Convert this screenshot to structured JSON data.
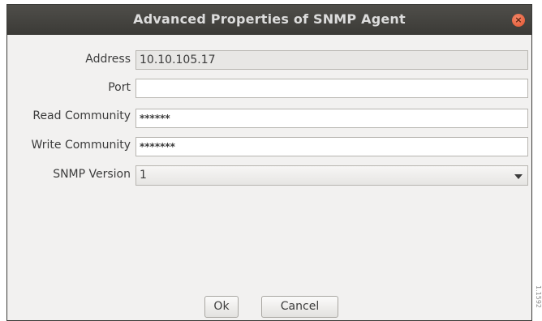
{
  "window": {
    "title": "Advanced Properties of SNMP Agent",
    "close_glyph": "×"
  },
  "form": {
    "address": {
      "label": "Address",
      "value": "10.10.105.17"
    },
    "port": {
      "label": "Port",
      "value": ""
    },
    "read_community": {
      "label": "Read Community",
      "value": "******"
    },
    "write_community": {
      "label": "Write Community",
      "value": "*******"
    },
    "snmp_version": {
      "label": "SNMP Version",
      "value": "1"
    }
  },
  "buttons": {
    "ok": "Ok",
    "cancel": "Cancel"
  },
  "figure_id": "1.1592"
}
